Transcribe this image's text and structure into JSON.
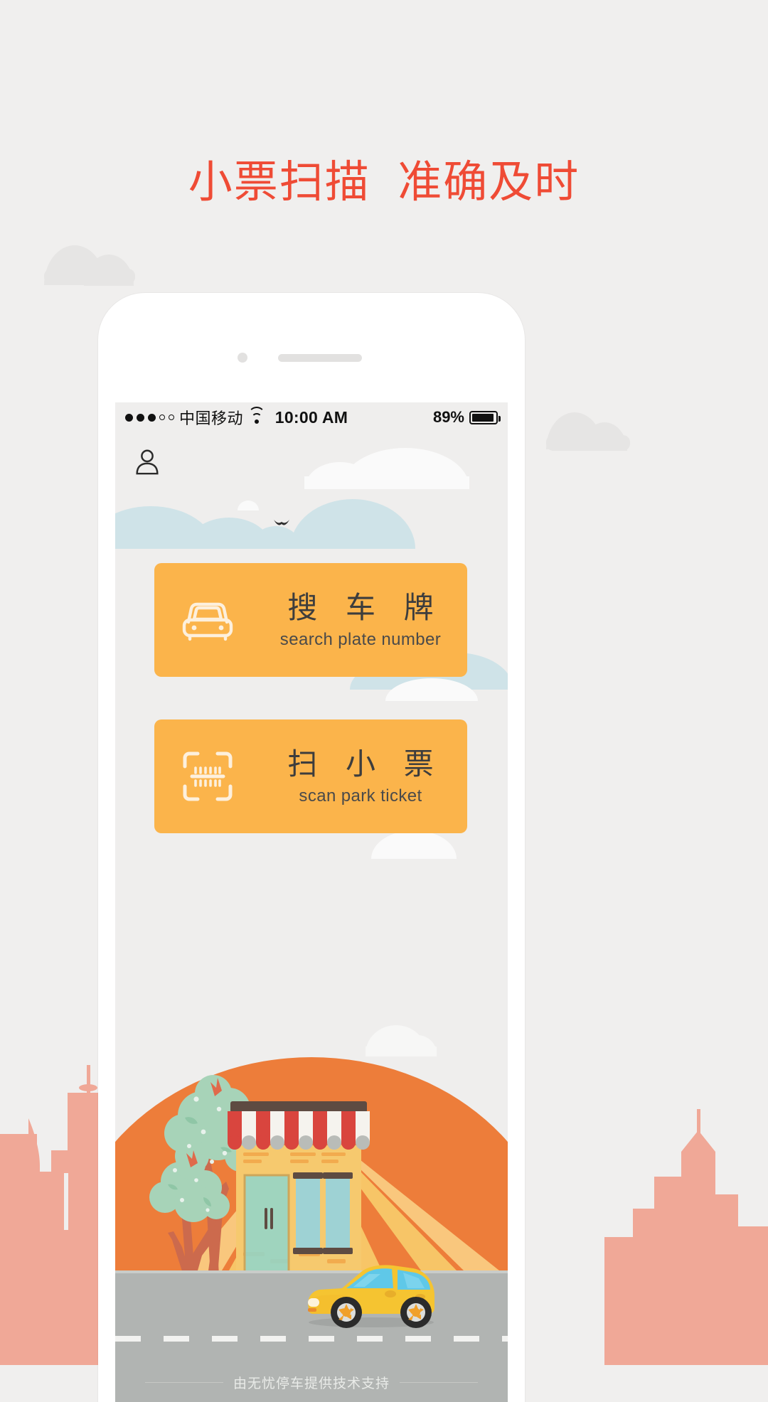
{
  "page": {
    "headline": "小票扫描  准确及时",
    "headline_color": "#ef4b35",
    "background_color": "#f0efee"
  },
  "status_bar": {
    "signal_dots_filled": 3,
    "signal_dots_total": 5,
    "carrier": "中国移动",
    "wifi_icon": "wifi-icon",
    "time": "10:00 AM",
    "battery_percent": "89%",
    "battery_level": 89
  },
  "app": {
    "account_icon": "user-icon",
    "cards": [
      {
        "icon": "car-icon",
        "title_cn": "搜 车 牌",
        "title_en": "search plate number",
        "color": "#fbb44b"
      },
      {
        "icon": "barcode-scan-icon",
        "title_cn": "扫 小 票",
        "title_en": "scan park ticket",
        "color": "#fbb44b"
      }
    ],
    "footer": {
      "text": "由无忧停车提供技术支持"
    },
    "scene": {
      "shop_icon": "storefront-illustration",
      "tree_icon": "tree-illustration",
      "car_icon": "yellow-car-illustration",
      "cloud_icon": "cloud-illustration",
      "bird_icon": "bird-illustration",
      "hill_color": "#ed7d3a",
      "road_color": "#b1b4b2",
      "sky_hill_color": "#cfe3e8"
    }
  }
}
